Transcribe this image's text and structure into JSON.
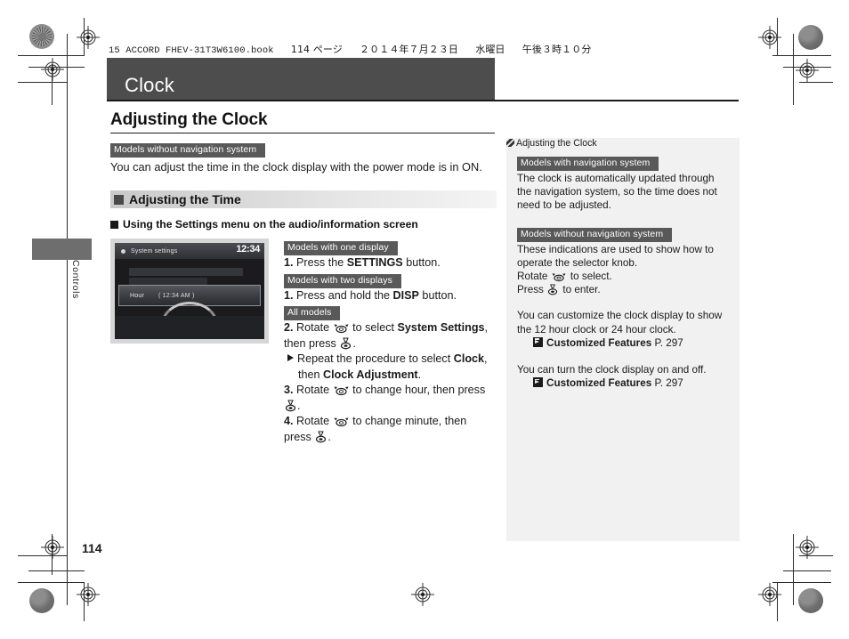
{
  "document_header": {
    "filename": "15 ACCORD FHEV-31T3W6100.book",
    "page_marker": "114 ページ",
    "date": "２０１４年７月２３日",
    "weekday": "水曜日",
    "time": "午後３時１０分"
  },
  "chapter": {
    "title": "Clock"
  },
  "thumb_tab": {
    "label": "Controls"
  },
  "main": {
    "heading": "Adjusting the Clock",
    "intro_tag": "Models without navigation system",
    "intro_text": "You can adjust the time in the clock display with the power mode is in ON.",
    "section_title": "Adjusting the Time",
    "subsection_title": "Using the Settings menu on the audio/information screen",
    "figure": {
      "screen_title": "System settings",
      "screen_clock": "12:34",
      "row_label": "Hour",
      "row_value": "( 12:34 AM )"
    },
    "steps": [
      {
        "tag": "Models with one display",
        "number": "1.",
        "text_before": " Press the ",
        "bold": "SETTINGS",
        "text_after": " button."
      },
      {
        "tag": "Models with two displays",
        "number": "1.",
        "text_before": " Press and hold the ",
        "bold": "DISP",
        "text_after": " button."
      }
    ],
    "all_models_tag": "All models",
    "step2": {
      "number": "2.",
      "part1": " Rotate ",
      "icon_rotate": "rotate-knob-icon",
      "part2": " to select ",
      "bold1": "System Settings",
      "part3": ", then press ",
      "icon_press": "press-knob-icon",
      "part4": "."
    },
    "step2_sub": {
      "part1": "Repeat the procedure to select ",
      "bold1": "Clock",
      "part2": ", then ",
      "bold2": "Clock Adjustment",
      "part3": "."
    },
    "step3": {
      "number": "3.",
      "part1": " Rotate ",
      "part2": " to change hour, then press ",
      "part3": "."
    },
    "step4": {
      "number": "4.",
      "part1": " Rotate ",
      "part2": " to change minute, then press ",
      "part3": "."
    }
  },
  "side_panel": {
    "heading": "Adjusting the Clock",
    "block1": {
      "tag": "Models with navigation system",
      "text": "The clock is automatically updated through the navigation system, so the time does not need to be adjusted."
    },
    "block2": {
      "tag": "Models without navigation system",
      "text": "These indications are used to show how to operate the selector knob.",
      "line_rotate_before": "Rotate ",
      "line_rotate_after": " to select.",
      "line_press_before": "Press ",
      "line_press_after": " to enter."
    },
    "block3": {
      "text": "You can customize the clock display to show the 12 hour clock or 24 hour clock.",
      "xref_bold": "Customized Features",
      "xref_page": " P. 297"
    },
    "block4": {
      "text": "You can turn the clock display on and off.",
      "xref_bold": "Customized Features",
      "xref_page": " P. 297"
    }
  },
  "page_number": "114",
  "colors": {
    "chapter_bar": "#4d4d4d",
    "tag_bg": "#595959",
    "side_panel_bg": "#f1f1f1",
    "band_start": "#c9c9c9",
    "text": "#1b1b1b"
  }
}
